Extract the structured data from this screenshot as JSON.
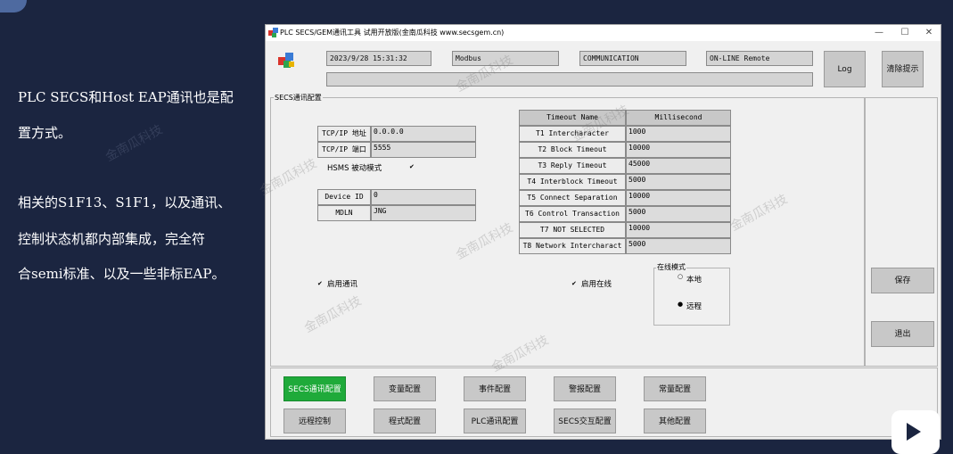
{
  "slide": {
    "lines": [
      "PLC SECS和Host EAP通讯也是配",
      "置方式。",
      "相关的S1F13、S1F1，以及通讯、",
      "控制状态机都内部集成，完全符",
      "合semi标准、以及一些非标EAP。"
    ]
  },
  "window": {
    "title": "PLC SECS/GEM通讯工具 试用开放版(金南瓜科技 www.secsgem.cn)",
    "buttons": {
      "minimize": "—",
      "maximize": "☐",
      "close": "✕"
    }
  },
  "status": {
    "datetime": "2023/9/28 15:31:32",
    "protocol": "Modbus",
    "comm_state": "COMMUNICATION",
    "control_state": "ON-LINE Remote",
    "message": ""
  },
  "toolbar": {
    "log": "Log",
    "clear": "清除提示"
  },
  "secs": {
    "group_label": "SECS通讯配置",
    "tcp_ip_label": "TCP/IP 地址",
    "tcp_ip_value": "0.0.0.0",
    "tcp_port_label": "TCP/IP 端口",
    "tcp_port_value": "5555",
    "hsms_passive_label": "HSMS 被动模式",
    "hsms_passive_checked": true,
    "device_id_label": "Device ID",
    "device_id_value": "0",
    "mdln_label": "MDLN",
    "mdln_value": "JNG",
    "enable_comm_label": "启用通讯",
    "enable_comm_checked": true,
    "enable_online_label": "启用在线",
    "enable_online_checked": true,
    "online_mode": {
      "label": "在线模式",
      "options": [
        "本地",
        "远程"
      ],
      "selected": "远程"
    },
    "timeouts": {
      "headers": [
        "Timeout Name",
        "Millisecond"
      ],
      "rows": [
        {
          "name": "T1 Intercharacter",
          "value": "1000"
        },
        {
          "name": "T2 Block Timeout",
          "value": "10000"
        },
        {
          "name": "T3 Reply Timeout",
          "value": "45000"
        },
        {
          "name": "T4 Interblock Timeout",
          "value": "5000"
        },
        {
          "name": "T5 Connect Separation",
          "value": "10000"
        },
        {
          "name": "T6 Control Transaction",
          "value": "5000"
        },
        {
          "name": "T7 NOT SELECTED",
          "value": "10000"
        },
        {
          "name": "T8 Network Intercharact",
          "value": "5000"
        }
      ]
    }
  },
  "side_buttons": {
    "save": "保存",
    "exit": "退出"
  },
  "nav": {
    "row1": [
      "SECS通讯配置",
      "变量配置",
      "事件配置",
      "警报配置",
      "常量配置"
    ],
    "row2": [
      "远程控制",
      "程式配置",
      "PLC通讯配置",
      "SECS交互配置",
      "其他配置"
    ],
    "active": "SECS通讯配置"
  },
  "watermark": "金南瓜科技",
  "colors": {
    "active_nav": "#1faa3a",
    "background": "#1b2540"
  }
}
